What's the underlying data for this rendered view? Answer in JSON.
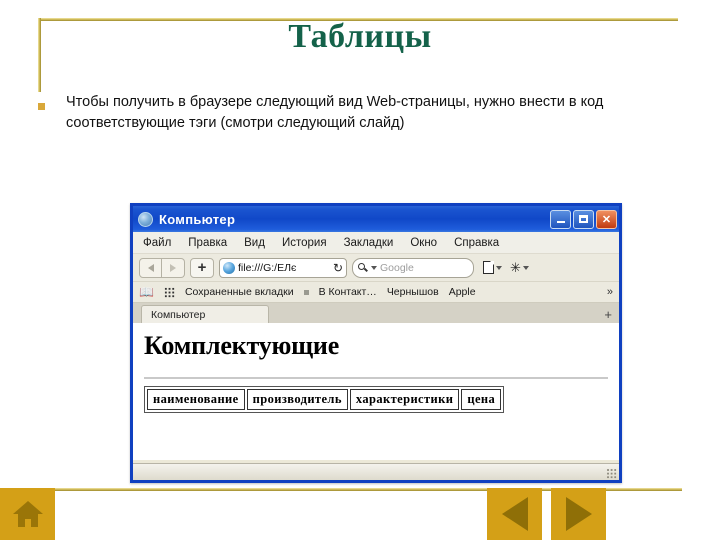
{
  "slide": {
    "title": "Таблицы",
    "bullet_text": "Чтобы получить в браузере следующий вид Web-страницы, нужно внести в код соответствующие тэги (смотри следующий слайд)",
    "accent_gold": "#c9b44e",
    "title_color": "#14624a",
    "nav_button_color": "#d4a017"
  },
  "browser": {
    "window_title": "Компьютер",
    "window_buttons": {
      "minimize": "_",
      "maximize": "□",
      "close": "✕"
    },
    "menu": [
      "Файл",
      "Правка",
      "Вид",
      "История",
      "Закладки",
      "Окно",
      "Справка"
    ],
    "toolbar": {
      "back": "◀",
      "forward": "▶",
      "new": "+",
      "url_value": "file:///G:/ЕЛє",
      "reload": "↻",
      "search_placeholder": "Google",
      "page_menu": "▾",
      "settings_menu": "▾"
    },
    "bookmarks": {
      "saved_tabs": "Сохраненные вкладки",
      "items": [
        "В Контакт…",
        "Чернышов",
        "Apple"
      ],
      "overflow": "»"
    },
    "tabs": {
      "active_label": "Компьютер",
      "new_tab": "+"
    },
    "page": {
      "heading": "Комплектующие",
      "table_headers": [
        "наименование",
        "производитель",
        "характеристики",
        "цена"
      ]
    }
  },
  "nav": {
    "home": "home-icon",
    "back": "back-arrow-icon",
    "forward": "forward-arrow-icon"
  }
}
